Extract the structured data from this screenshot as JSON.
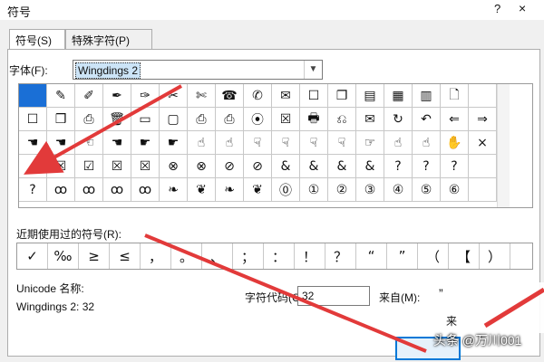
{
  "window": {
    "title": "符号",
    "help": "?",
    "close": "×"
  },
  "tabs": [
    {
      "label": "符号(S)",
      "active": true
    },
    {
      "label": "特殊字符(P)",
      "active": false
    }
  ],
  "font": {
    "label": "字体(F):",
    "value": "Wingdings 2"
  },
  "symbols": [
    [
      "",
      "✎",
      "✐",
      "✒",
      "✑",
      "✂",
      "✄",
      "☎",
      "✆",
      "✉",
      "☐",
      "❐",
      "▤",
      "▦",
      "▥",
      "🗋",
      ""
    ],
    [
      "☐",
      "❒",
      "⎙",
      "🗑",
      "▭",
      "▢",
      "⎙",
      "⎙",
      "⦿",
      "☒",
      "🖶",
      "⎌",
      "✉",
      "↻",
      "↶",
      "⇐",
      "⇒"
    ],
    [
      "☚",
      "☚",
      "☜",
      "☚",
      "☛",
      "☛",
      "☝",
      "☝",
      "☟",
      "☟",
      "☟",
      "☟",
      "☞",
      "☝",
      "☝",
      "✋",
      "×"
    ],
    [
      "✓",
      "☒",
      "☑",
      "☒",
      "☒",
      "⊗",
      "⊗",
      "⊘",
      "⊘",
      "&",
      "&",
      "&",
      "&",
      "?",
      "?",
      "?",
      ""
    ],
    [
      "?",
      "ꝏ",
      "ꝏ",
      "ꝏ",
      "ꝏ",
      "❧",
      "❦",
      "❧",
      "❦",
      "⓪",
      "①",
      "②",
      "③",
      "④",
      "⑤",
      "⑥",
      ""
    ]
  ],
  "recent": {
    "label": "近期使用过的符号(R):",
    "items": [
      "✓",
      "‰",
      "≥",
      "≤",
      "，",
      "。",
      "、",
      "；",
      "：",
      "！",
      "？",
      "“",
      "”",
      "（",
      "【",
      "）"
    ]
  },
  "unicode": {
    "label": "Unicode 名称:",
    "value": "Wingdings 2: 32"
  },
  "char_code": {
    "label": "字符代码(C):",
    "value": "32"
  },
  "from": {
    "label": "来自(M):"
  },
  "overlay": {
    "quote": "”",
    "partial": "来"
  },
  "watermark": "头条 @万川001",
  "colors": {
    "selected": "#1a6fd6",
    "arrow": "#e23a3a",
    "tab_border": "#adadad"
  }
}
